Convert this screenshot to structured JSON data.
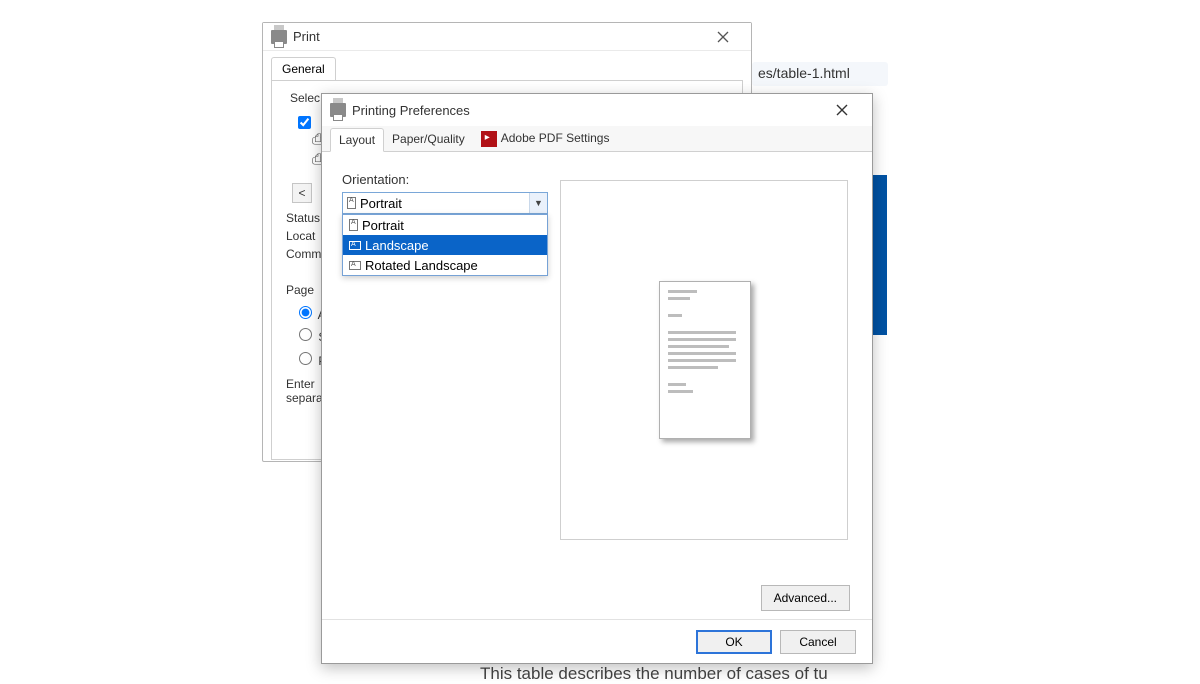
{
  "background": {
    "address_fragment": "es/table-1.html",
    "caption_fragment": "This table describes the number of cases of tu"
  },
  "print_dialog": {
    "title": "Print",
    "tab_general": "General",
    "select_label": "Selec",
    "status_label": "Status",
    "location_label": "Locat",
    "comment_label": "Comm",
    "page_range_label": "Page",
    "range_all": "Al",
    "range_selection": "Se",
    "range_pages": "Pa",
    "enter_pages_line1": "Enter",
    "enter_pages_line2": "separa"
  },
  "pref_dialog": {
    "title": "Printing Preferences",
    "tabs": {
      "layout": "Layout",
      "paper_quality": "Paper/Quality",
      "pdf_settings": "Adobe PDF Settings"
    },
    "orientation_label": "Orientation:",
    "orientation_selected": "Portrait",
    "orientation_options": {
      "portrait": "Portrait",
      "landscape": "Landscape",
      "rotated": "Rotated Landscape"
    },
    "advanced": "Advanced...",
    "ok": "OK",
    "cancel": "Cancel"
  }
}
